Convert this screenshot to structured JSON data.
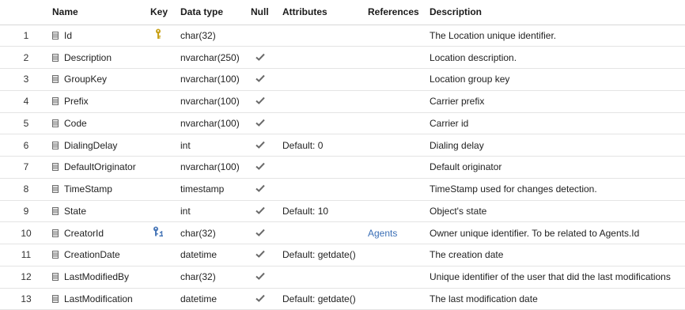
{
  "columns": {
    "num": "",
    "name": "Name",
    "key": "Key",
    "type": "Data type",
    "null": "Null",
    "attributes": "Attributes",
    "references": "References",
    "description": "Description"
  },
  "rows": [
    {
      "num": "1",
      "name": "Id",
      "key": "primary-key",
      "type": "char(32)",
      "nullable": false,
      "attributes": "",
      "references": "",
      "description": "The Location unique identifier."
    },
    {
      "num": "2",
      "name": "Description",
      "key": "",
      "type": "nvarchar(250)",
      "nullable": true,
      "attributes": "",
      "references": "",
      "description": "Location description."
    },
    {
      "num": "3",
      "name": "GroupKey",
      "key": "",
      "type": "nvarchar(100)",
      "nullable": true,
      "attributes": "",
      "references": "",
      "description": "Location group key"
    },
    {
      "num": "4",
      "name": "Prefix",
      "key": "",
      "type": "nvarchar(100)",
      "nullable": true,
      "attributes": "",
      "references": "",
      "description": "Carrier prefix"
    },
    {
      "num": "5",
      "name": "Code",
      "key": "",
      "type": "nvarchar(100)",
      "nullable": true,
      "attributes": "",
      "references": "",
      "description": "Carrier id"
    },
    {
      "num": "6",
      "name": "DialingDelay",
      "key": "",
      "type": "int",
      "nullable": true,
      "attributes": "Default: 0",
      "references": "",
      "description": "Dialing delay"
    },
    {
      "num": "7",
      "name": "DefaultOriginator",
      "key": "",
      "type": "nvarchar(100)",
      "nullable": true,
      "attributes": "",
      "references": "",
      "description": "Default originator"
    },
    {
      "num": "8",
      "name": "TimeStamp",
      "key": "",
      "type": "timestamp",
      "nullable": true,
      "attributes": "",
      "references": "",
      "description": "TimeStamp used for changes detection."
    },
    {
      "num": "9",
      "name": "State",
      "key": "",
      "type": "int",
      "nullable": true,
      "attributes": "Default: 10",
      "references": "",
      "description": "Object's state"
    },
    {
      "num": "10",
      "name": "CreatorId",
      "key": "foreign-key",
      "type": "char(32)",
      "nullable": true,
      "attributes": "",
      "references": "Agents",
      "description": "Owner unique identifier. To be related to Agents.Id"
    },
    {
      "num": "11",
      "name": "CreationDate",
      "key": "",
      "type": "datetime",
      "nullable": true,
      "attributes": "Default: getdate()",
      "references": "",
      "description": "The creation date"
    },
    {
      "num": "12",
      "name": "LastModifiedBy",
      "key": "",
      "type": "char(32)",
      "nullable": true,
      "attributes": "",
      "references": "",
      "description": "Unique identifier of the user that did the last modifications"
    },
    {
      "num": "13",
      "name": "LastModification",
      "key": "",
      "type": "datetime",
      "nullable": true,
      "attributes": "Default: getdate()",
      "references": "",
      "description": "The last modification date"
    }
  ],
  "icons": {
    "column": "column-icon",
    "primary_key": "key-icon",
    "foreign_key": "foreign-key-icon",
    "nullable": "check-icon"
  },
  "colors": {
    "key_gold": "#c9a21a",
    "fk_blue": "#4a78b8",
    "check_gray": "#6a6a6a",
    "link_blue": "#3b6fb6"
  }
}
